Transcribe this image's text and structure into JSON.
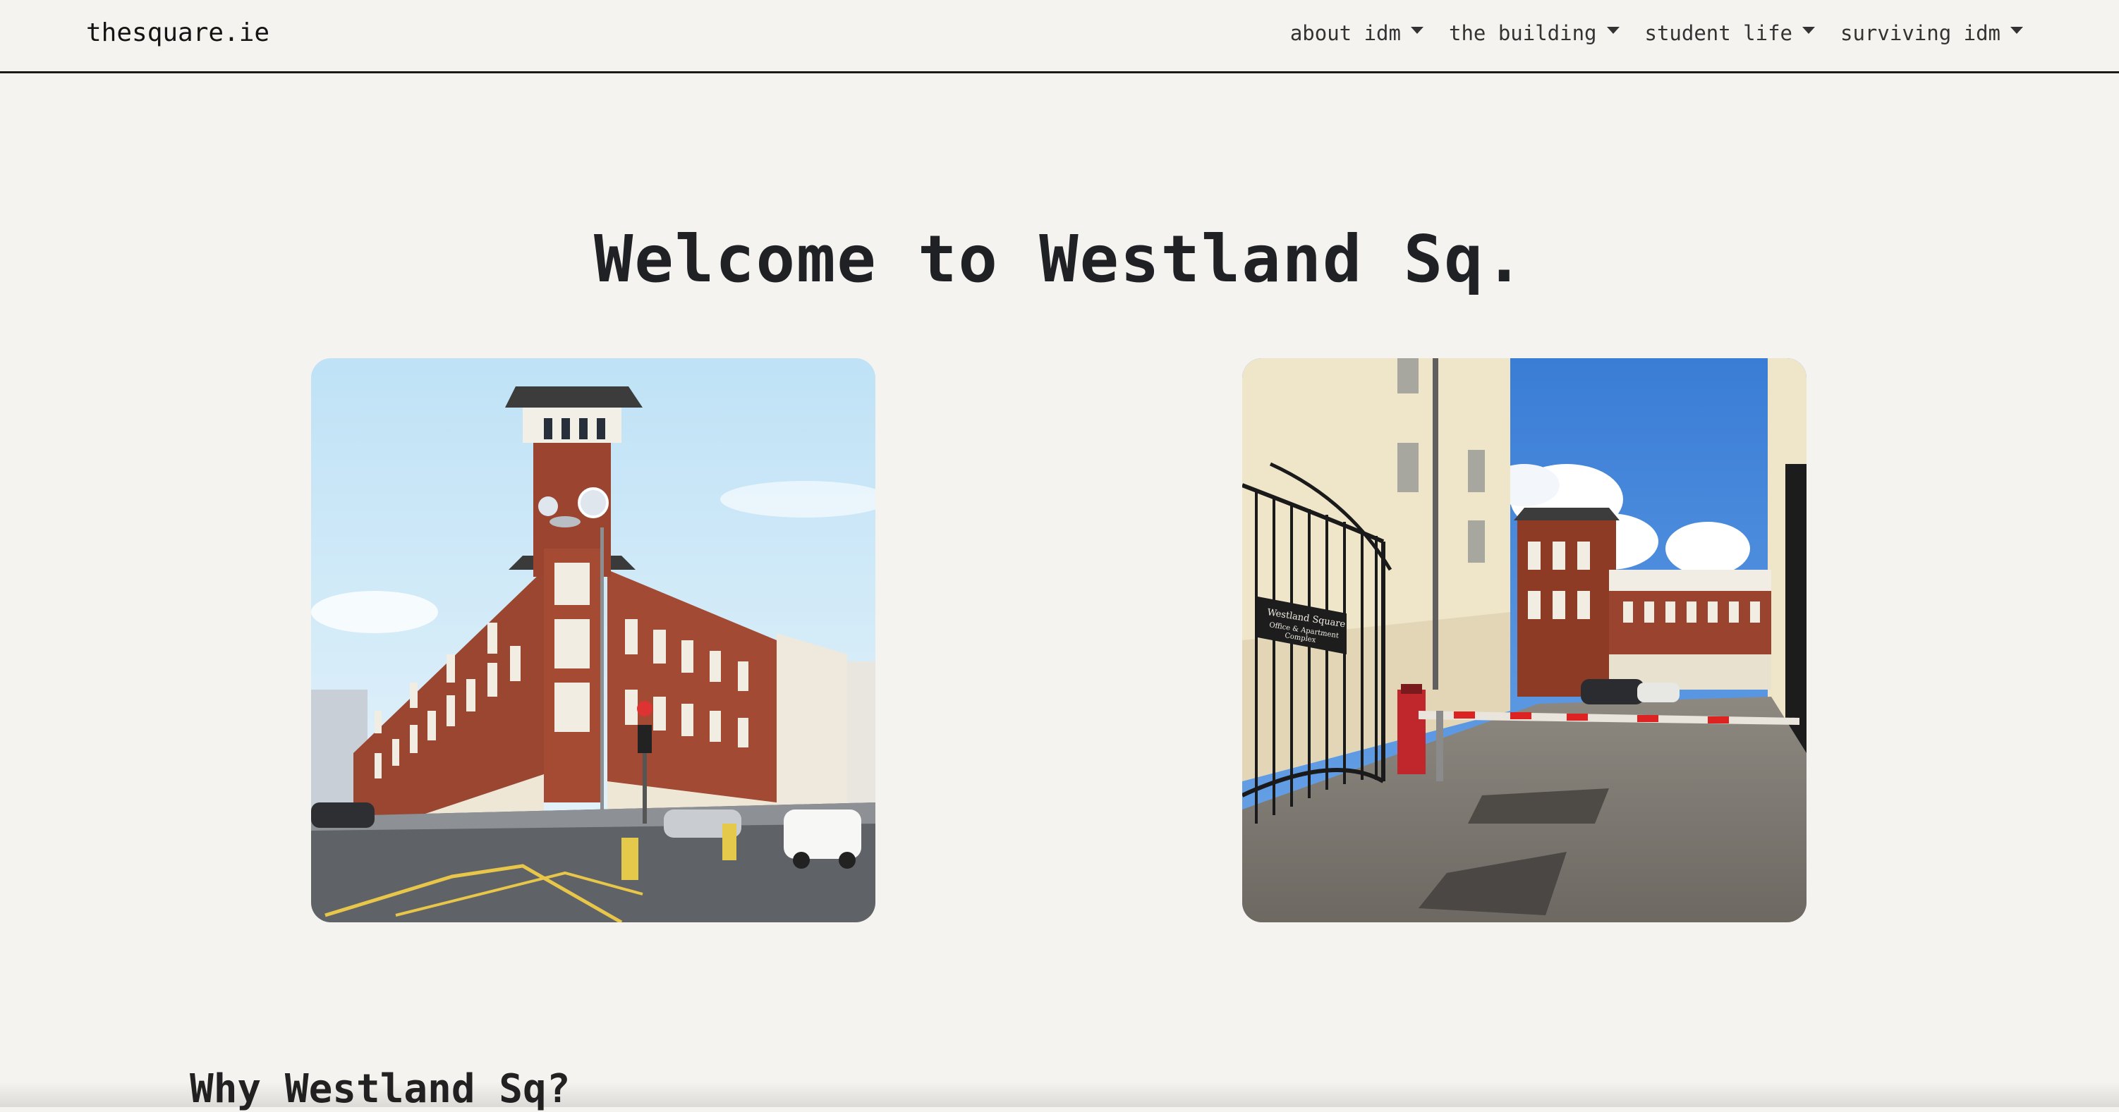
{
  "navbar": {
    "brand": "thesquare.ie",
    "items": [
      {
        "label": "about idm"
      },
      {
        "label": "the building"
      },
      {
        "label": "student life"
      },
      {
        "label": "surviving idm"
      }
    ]
  },
  "hero": {
    "title": "Welcome to Westland Sq."
  },
  "photos": {
    "left_sign": "",
    "right_sign_line1": "Westland Square",
    "right_sign_line2": "Office & Apartment",
    "right_sign_line3": "Complex"
  },
  "section": {
    "title": "Why Westland Sq?"
  },
  "colors": {
    "background": "#f4f3ef",
    "text": "#202124",
    "brick": "#8e3b26",
    "sky": "#cfe8f5"
  }
}
